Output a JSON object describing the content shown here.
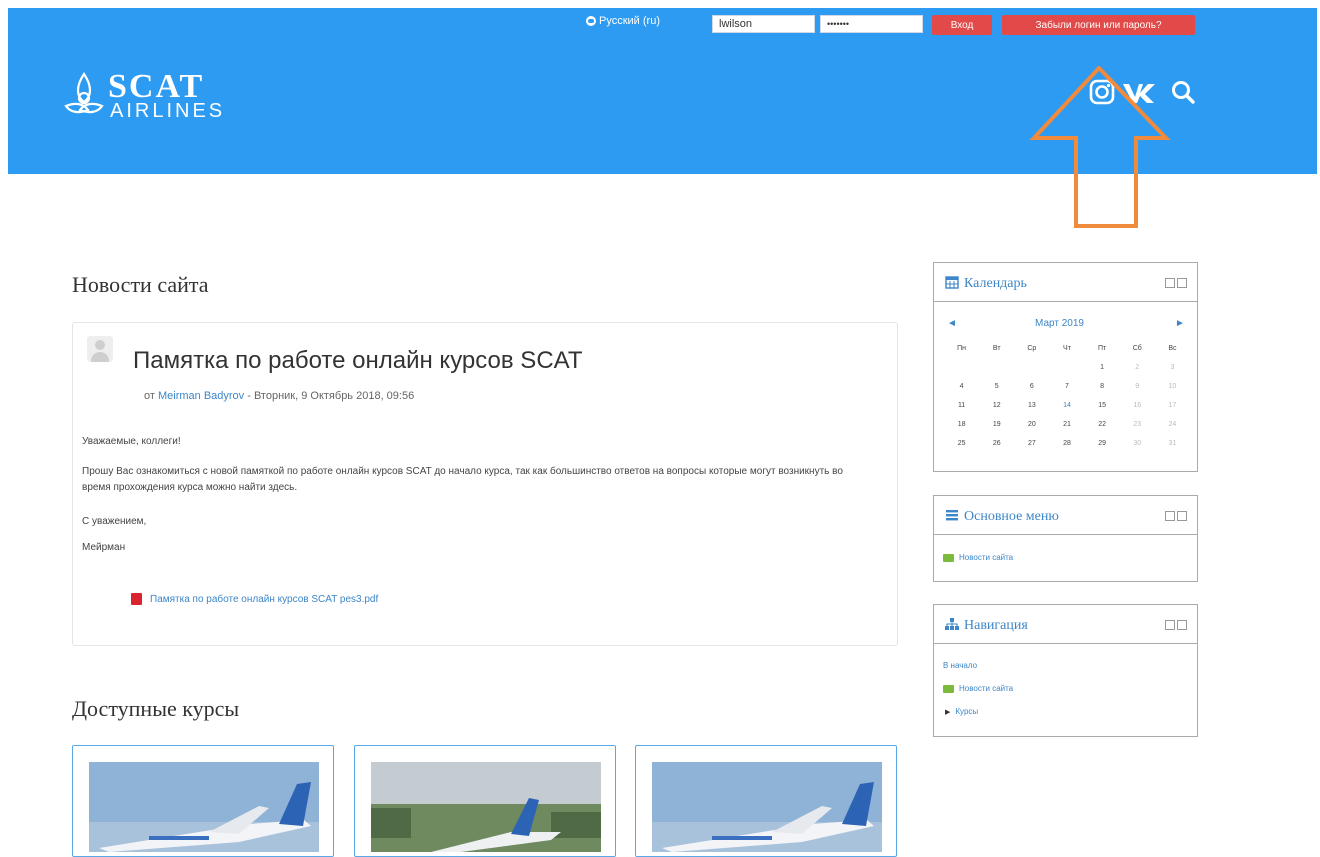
{
  "topbar": {
    "language": "Русский (ru)",
    "username_value": "lwilson",
    "password_value": "•••••••",
    "login_label": "Вход",
    "forgot_label": "Забыли логин или пароль?"
  },
  "header": {
    "brand_line1": "SCAT",
    "brand_line2": "AIRLINES",
    "social_icons": [
      "instagram-icon",
      "vk-icon",
      "search-icon"
    ]
  },
  "main": {
    "news_title": "Новости сайта",
    "post": {
      "title": "Памятка по работе онлайн курсов SCAT",
      "by": "от",
      "author": "Meirman Badyrov",
      "date": " - Вторник, 9 Октябрь 2018, 09:56",
      "greeting": "Уважаемые, коллеги!",
      "body": "Прошу Вас ознакомиться с новой памяткой по работе онлайн курсов SCAT до начало курса, так как большинство ответов на вопросы которые могут возникнуть во время прохождения курса можно найти здесь.",
      "regards": "С уважением,",
      "signature": "Мейрман",
      "attachment": "Памятка по работе онлайн курсов SCAT pes3.pdf"
    },
    "courses_title": "Доступные курсы"
  },
  "calendar": {
    "title": "Календарь",
    "month": "Март 2019",
    "prev": "◄",
    "next": "►",
    "weekdays": [
      "Пн",
      "Вт",
      "Ср",
      "Чт",
      "Пт",
      "Сб",
      "Вс"
    ],
    "weeks": [
      [
        "",
        "",
        "",
        "",
        "1",
        "2",
        "3"
      ],
      [
        "4",
        "5",
        "6",
        "7",
        "8",
        "9",
        "10"
      ],
      [
        "11",
        "12",
        "13",
        "14",
        "15",
        "16",
        "17"
      ],
      [
        "18",
        "19",
        "20",
        "21",
        "22",
        "23",
        "24"
      ],
      [
        "25",
        "26",
        "27",
        "28",
        "29",
        "30",
        "31"
      ]
    ]
  },
  "main_menu": {
    "title": "Основное меню",
    "items": [
      "Новости сайта"
    ]
  },
  "navigation": {
    "title": "Навигация",
    "home": "В начало",
    "items": [
      "Новости сайта",
      "Курсы"
    ]
  },
  "colors": {
    "brand_blue": "#2e9bf2",
    "button_red": "#e24a4a",
    "link_blue": "#3d86c8",
    "arrow_orange": "#f08a3c"
  }
}
